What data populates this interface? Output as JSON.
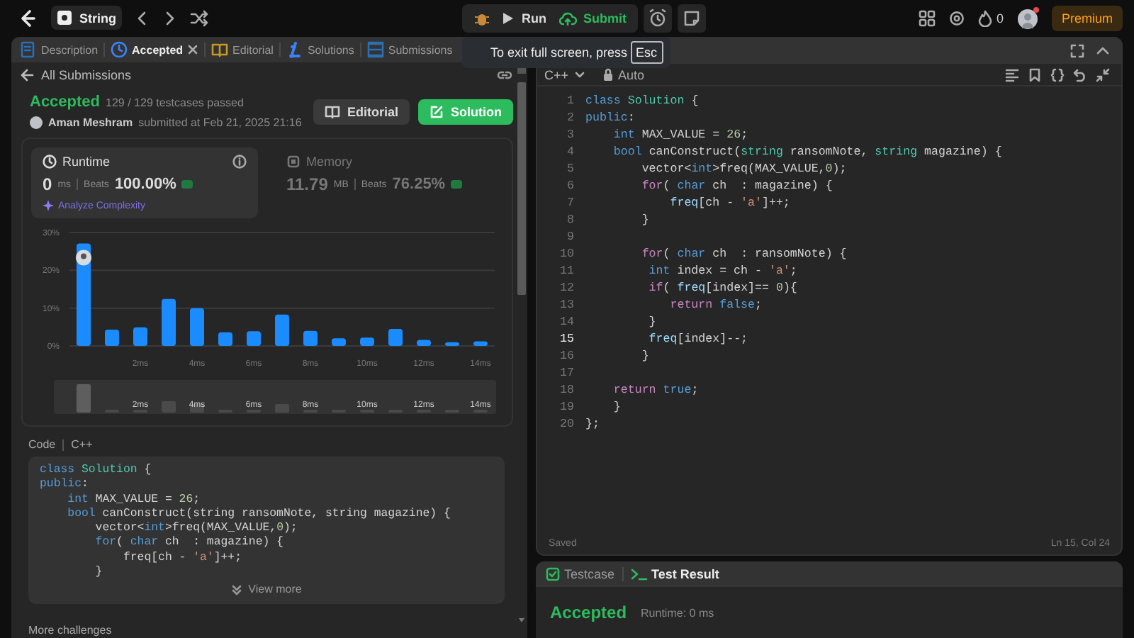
{
  "topbar": {
    "problem_list": "String",
    "run": "Run",
    "submit": "Submit",
    "streak": "0",
    "premium": "Premium"
  },
  "fullscreen_hint": {
    "text": "To exit full screen, press",
    "key": "Esc"
  },
  "left_tabs": [
    {
      "label": "Description",
      "selected": false,
      "closable": false
    },
    {
      "label": "Accepted",
      "selected": true,
      "closable": true
    },
    {
      "label": "Editorial",
      "selected": false,
      "closable": false
    },
    {
      "label": "Solutions",
      "selected": false,
      "closable": false
    },
    {
      "label": "Submissions",
      "selected": false,
      "closable": false
    }
  ],
  "back_link": "All Submissions",
  "submission": {
    "status": "Accepted",
    "testcases": "129 / 129 testcases passed",
    "author": "Aman Meshram",
    "submitted": "submitted at Feb 21, 2025 21:16",
    "buttons": [
      {
        "label": "Editorial",
        "kind": "secondary"
      },
      {
        "label": "Solution",
        "kind": "primary"
      }
    ]
  },
  "stats": [
    {
      "title": "Runtime",
      "value": "0",
      "unit": "ms",
      "beats_label": "Beats",
      "beats": "100.00%",
      "selected": true,
      "link": "Analyze Complexity"
    },
    {
      "title": "Memory",
      "value": "11.79",
      "unit": "MB",
      "beats_label": "Beats",
      "beats": "76.25%",
      "selected": false
    }
  ],
  "chart_data": {
    "type": "bar",
    "x": [
      0,
      1,
      2,
      3,
      4,
      5,
      6,
      7,
      8,
      9,
      10,
      11,
      12,
      13,
      14
    ],
    "values": [
      27.1,
      4.3,
      4.9,
      12.4,
      10,
      3.6,
      3.9,
      8.3,
      4,
      2,
      2.2,
      4.5,
      1.6,
      1,
      1.2
    ],
    "xlim": [
      -0.5,
      14.5
    ],
    "ylim": [
      0,
      30
    ],
    "yticks": [
      {
        "value": 0,
        "label": "0%"
      },
      {
        "value": 10,
        "label": "10%"
      },
      {
        "value": 20,
        "label": "20%"
      },
      {
        "value": 30,
        "label": "30%"
      }
    ],
    "xticks": [
      {
        "value": 2,
        "label": "2ms"
      },
      {
        "value": 4,
        "label": "4ms"
      },
      {
        "value": 6,
        "label": "6ms"
      },
      {
        "value": 8,
        "label": "8ms"
      },
      {
        "value": 10,
        "label": "10ms"
      },
      {
        "value": 12,
        "label": "12ms"
      },
      {
        "value": 14,
        "label": "14ms"
      }
    ]
  },
  "navigator": {
    "labels": [
      "2ms",
      "4ms",
      "6ms",
      "8ms",
      "10ms",
      "12ms",
      "14ms"
    ]
  },
  "code_section": {
    "label": "Code",
    "language": "C++",
    "view_more": "View more",
    "lines": [
      [
        {
          "kind": "keyword",
          "text": "class "
        },
        {
          "kind": "type",
          "text": "Solution"
        },
        {
          "kind": "plain",
          "text": " {"
        }
      ],
      [
        {
          "kind": "keyword",
          "text": "public"
        },
        {
          "kind": "plain",
          "text": ":"
        }
      ],
      [
        {
          "kind": "keyword",
          "text": "    int"
        },
        {
          "kind": "plain",
          "text": " MAX_VALUE = "
        },
        {
          "kind": "number",
          "text": "26"
        },
        {
          "kind": "plain",
          "text": ";"
        }
      ],
      [
        {
          "kind": "keyword",
          "text": "    bool"
        },
        {
          "kind": "plain",
          "text": " canConstruct(string ransomNote, string magazine) {"
        }
      ],
      [
        {
          "kind": "plain",
          "text": "        vector<"
        },
        {
          "kind": "keyword",
          "text": "int"
        },
        {
          "kind": "plain",
          "text": ">freq(MAX_VALUE,"
        },
        {
          "kind": "number",
          "text": "0"
        },
        {
          "kind": "plain",
          "text": ");"
        }
      ],
      [
        {
          "kind": "keyword",
          "text": "        for"
        },
        {
          "kind": "plain",
          "text": "( "
        },
        {
          "kind": "keyword",
          "text": "char"
        },
        {
          "kind": "plain",
          "text": " ch  : magazine) {"
        }
      ],
      [
        {
          "kind": "plain",
          "text": "            freq[ch - "
        },
        {
          "kind": "string",
          "text": "'a'"
        },
        {
          "kind": "plain",
          "text": "]++;"
        }
      ],
      [
        {
          "kind": "plain",
          "text": "        }"
        }
      ]
    ]
  },
  "more": "More challenges",
  "editor": {
    "language": "C++",
    "mode": "Auto",
    "status": "Saved",
    "cursor": "Ln 15, Col 24",
    "lines": [
      {
        "number": "1",
        "active": false,
        "tokens": [
          {
            "kind": "keyword",
            "text": "class "
          },
          {
            "kind": "type",
            "text": "Solution"
          },
          {
            "kind": "plain",
            "text": " {"
          }
        ]
      },
      {
        "number": "2",
        "active": false,
        "tokens": [
          {
            "kind": "keyword",
            "text": "public"
          },
          {
            "kind": "plain",
            "text": ":"
          }
        ]
      },
      {
        "number": "3",
        "active": false,
        "tokens": [
          {
            "kind": "keyword",
            "text": "    int"
          },
          {
            "kind": "plain",
            "text": " MAX_VALUE = "
          },
          {
            "kind": "number",
            "text": "26"
          },
          {
            "kind": "plain",
            "text": ";"
          }
        ]
      },
      {
        "number": "4",
        "active": false,
        "tokens": [
          {
            "kind": "keyword",
            "text": "    bool"
          },
          {
            "kind": "plain",
            "text": " canConstruct("
          },
          {
            "kind": "type",
            "text": "string"
          },
          {
            "kind": "plain",
            "text": " ransomNote, "
          },
          {
            "kind": "type",
            "text": "string"
          },
          {
            "kind": "plain",
            "text": " magazine) {"
          }
        ]
      },
      {
        "number": "5",
        "active": false,
        "tokens": [
          {
            "kind": "plain",
            "text": "        vector<"
          },
          {
            "kind": "keyword",
            "text": "int"
          },
          {
            "kind": "plain",
            "text": ">freq(MAX_VALUE,"
          },
          {
            "kind": "number",
            "text": "0"
          },
          {
            "kind": "plain",
            "text": ");"
          }
        ]
      },
      {
        "number": "6",
        "active": false,
        "tokens": [
          {
            "kind": "control",
            "text": "        for"
          },
          {
            "kind": "plain",
            "text": "( "
          },
          {
            "kind": "keyword",
            "text": "char"
          },
          {
            "kind": "plain",
            "text": " ch  : magazine) {"
          }
        ]
      },
      {
        "number": "7",
        "active": false,
        "tokens": [
          {
            "kind": "variable",
            "text": "            freq"
          },
          {
            "kind": "plain",
            "text": "[ch - "
          },
          {
            "kind": "string",
            "text": "'a'"
          },
          {
            "kind": "plain",
            "text": "]++;"
          }
        ]
      },
      {
        "number": "8",
        "active": false,
        "tokens": [
          {
            "kind": "plain",
            "text": "        }"
          }
        ]
      },
      {
        "number": "9",
        "active": false
      },
      {
        "number": "10",
        "active": false,
        "tokens": [
          {
            "kind": "control",
            "text": "        for"
          },
          {
            "kind": "plain",
            "text": "( "
          },
          {
            "kind": "keyword",
            "text": "char"
          },
          {
            "kind": "plain",
            "text": " ch  : ransomNote) {"
          }
        ]
      },
      {
        "number": "11",
        "active": false,
        "tokens": [
          {
            "kind": "keyword",
            "text": "         int"
          },
          {
            "kind": "plain",
            "text": " index = ch - "
          },
          {
            "kind": "string",
            "text": "'a'"
          },
          {
            "kind": "plain",
            "text": ";"
          }
        ]
      },
      {
        "number": "12",
        "active": false,
        "tokens": [
          {
            "kind": "control",
            "text": "         if"
          },
          {
            "kind": "plain",
            "text": "( "
          },
          {
            "kind": "variable",
            "text": "freq"
          },
          {
            "kind": "plain",
            "text": "[index]== "
          },
          {
            "kind": "number",
            "text": "0"
          },
          {
            "kind": "plain",
            "text": "){"
          }
        ]
      },
      {
        "number": "13",
        "active": false,
        "tokens": [
          {
            "kind": "control",
            "text": "            return"
          },
          {
            "kind": "keyword",
            "text": " false"
          },
          {
            "kind": "plain",
            "text": ";"
          }
        ]
      },
      {
        "number": "14",
        "active": false,
        "tokens": [
          {
            "kind": "plain",
            "text": "         }"
          }
        ]
      },
      {
        "number": "15",
        "active": true,
        "tokens": [
          {
            "kind": "variable",
            "text": "         freq"
          },
          {
            "kind": "plain",
            "text": "[index]--;"
          }
        ]
      },
      {
        "number": "16",
        "active": false,
        "tokens": [
          {
            "kind": "plain",
            "text": "        }"
          }
        ]
      },
      {
        "number": "17",
        "active": false
      },
      {
        "number": "18",
        "active": false,
        "tokens": [
          {
            "kind": "control",
            "text": "    return"
          },
          {
            "kind": "keyword",
            "text": " true"
          },
          {
            "kind": "plain",
            "text": ";"
          }
        ]
      },
      {
        "number": "19",
        "active": false,
        "tokens": [
          {
            "kind": "plain",
            "text": "    }"
          }
        ]
      },
      {
        "number": "20",
        "active": false,
        "tokens": [
          {
            "kind": "plain",
            "text": "};"
          }
        ]
      }
    ]
  },
  "console": {
    "tabs": [
      {
        "label": "Testcase",
        "selected": false
      },
      {
        "label": "Test Result",
        "selected": true
      }
    ],
    "result": "Accepted",
    "runtime": "Runtime: 0 ms"
  }
}
